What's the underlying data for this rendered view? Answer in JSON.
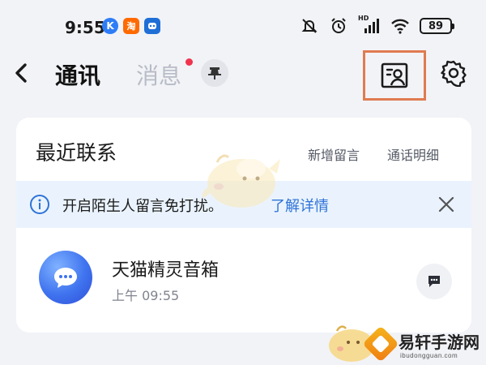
{
  "status_bar": {
    "time": "9:55",
    "apps": [
      "K",
      "淘",
      ""
    ],
    "battery": "89",
    "network_label": "HD"
  },
  "header": {
    "tabs": [
      {
        "label": "通讯",
        "active": true
      },
      {
        "label": "消息",
        "active": false,
        "has_badge": true
      }
    ],
    "icons": [
      "back-icon",
      "pin-icon",
      "contact-card-icon",
      "settings-gear-icon"
    ],
    "highlight_color": "#e07b50"
  },
  "card": {
    "title": "最近联系",
    "links": [
      "新增留言",
      "通话明细"
    ],
    "notice": {
      "text": "开启陌生人留言免打扰。",
      "link": "了解详情",
      "accent": "#2e73d8"
    },
    "items": [
      {
        "name": "天猫精灵音箱",
        "time": "上午 09:55"
      }
    ]
  },
  "watermark": {
    "title": "易轩手游网",
    "subtitle": "ibudongguan.com"
  }
}
